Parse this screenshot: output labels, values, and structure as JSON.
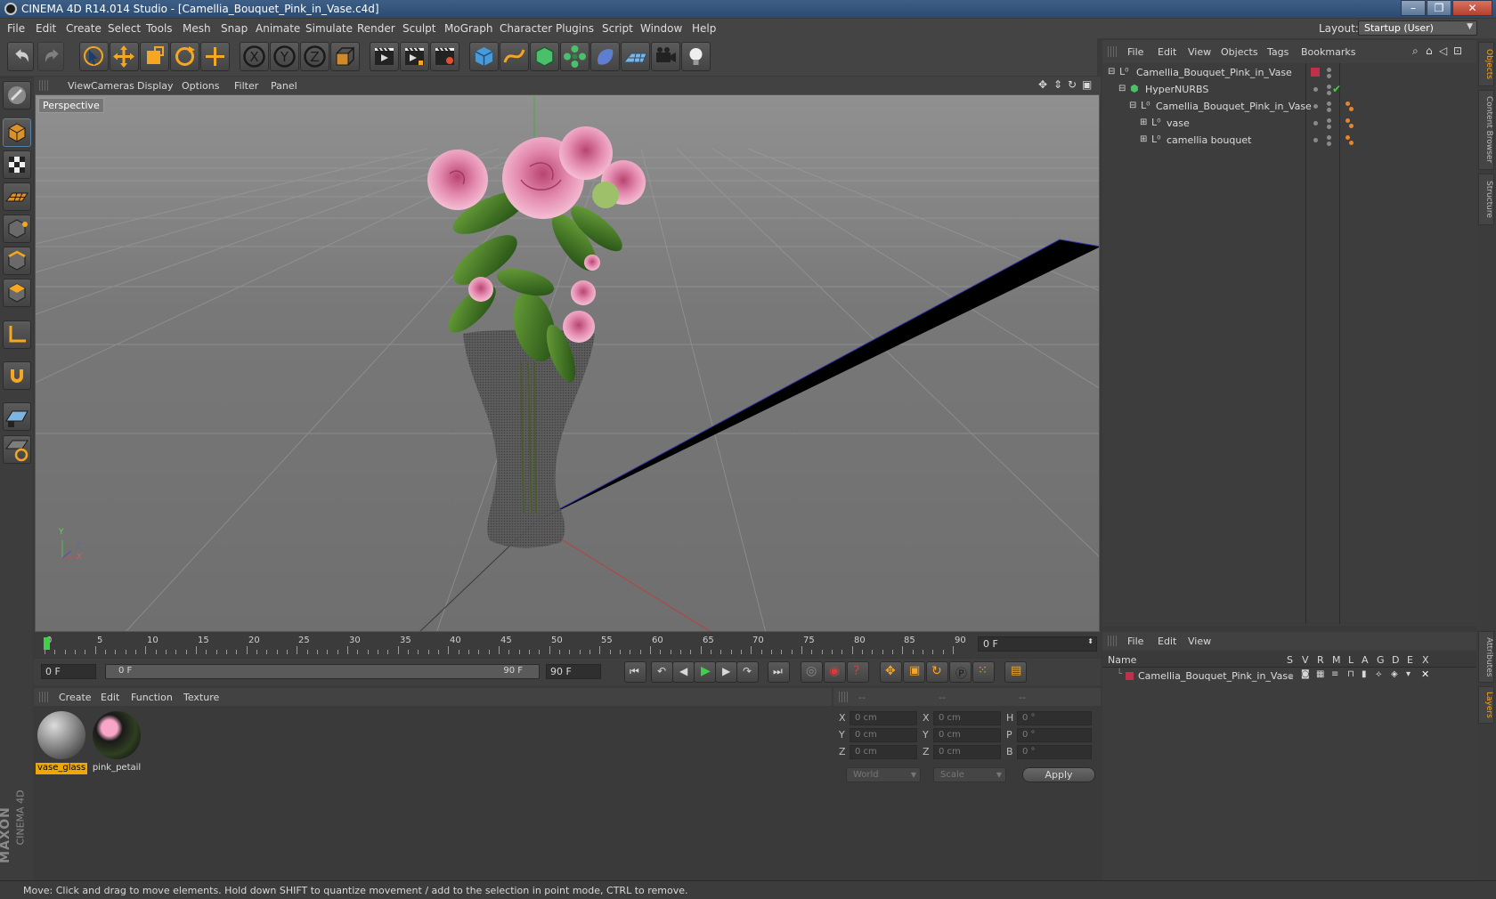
{
  "window": {
    "title": "CINEMA 4D R14.014 Studio - [Camellia_Bouquet_Pink_in_Vase.c4d]",
    "minimize": "–",
    "maximize": "❐",
    "close": "✕"
  },
  "menubar": {
    "items": [
      "File",
      "Edit",
      "Create",
      "Select",
      "Tools",
      "Mesh",
      "Snap",
      "Animate",
      "Simulate",
      "Render",
      "Sculpt",
      "MoGraph",
      "Character",
      "Plugins",
      "Script",
      "Window",
      "Help"
    ],
    "layout_label": "Layout:",
    "layout_value": "Startup (User)"
  },
  "toolbar": {
    "icons": [
      "undo-icon",
      "redo-icon",
      "live-select-icon",
      "move-icon",
      "scale-icon",
      "rotate-icon",
      "create-object-icon",
      "x-axis-icon",
      "y-axis-icon",
      "z-axis-icon",
      "coordinate-system-icon",
      "render-view-icon",
      "render-picture-viewer-icon",
      "edit-render-settings-icon",
      "cube-icon",
      "spline-pen-icon",
      "nurbs-icon",
      "array-icon",
      "deformer-icon",
      "floor-icon",
      "camera-icon",
      "light-icon"
    ]
  },
  "left_tools": {
    "icons": [
      "make-editable-icon",
      "model-mode-icon",
      "texture-mode-icon",
      "workplane-mode-icon",
      "points-mode-icon",
      "edges-mode-icon",
      "polygons-mode-icon",
      "axis-mode-icon",
      "magnet-icon",
      "snap-icon",
      "lock-workplane-icon"
    ]
  },
  "viewport": {
    "menu": [
      "View",
      "Cameras",
      "Display",
      "Options",
      "Filter",
      "Panel"
    ],
    "label": "Perspective",
    "axis_labels": {
      "y": "Y",
      "z": "Z",
      "x": "X"
    }
  },
  "timeline": {
    "ticks": [
      "0",
      "5",
      "10",
      "15",
      "20",
      "25",
      "30",
      "35",
      "40",
      "45",
      "50",
      "55",
      "60",
      "65",
      "70",
      "75",
      "80",
      "85",
      "90"
    ],
    "current_frame": "0 F"
  },
  "playbar": {
    "start_field": "0 F",
    "range_start": "0 F",
    "range_end": "90 F",
    "end_field": "90 F"
  },
  "material_manager": {
    "menu": [
      "Create",
      "Edit",
      "Function",
      "Texture"
    ],
    "materials": [
      {
        "name": "vase_glass",
        "selected": true
      },
      {
        "name": "pink_petail",
        "selected": false
      }
    ]
  },
  "coordinates": {
    "header": [
      "--",
      "--",
      "--"
    ],
    "rows": [
      {
        "axis": "X",
        "pos": "0 cm",
        "axis2": "X",
        "size": "0 cm",
        "rot_label": "H",
        "rot": "0 °"
      },
      {
        "axis": "Y",
        "pos": "0 cm",
        "axis2": "Y",
        "size": "0 cm",
        "rot_label": "P",
        "rot": "0 °"
      },
      {
        "axis": "Z",
        "pos": "0 cm",
        "axis2": "Z",
        "size": "0 cm",
        "rot_label": "B",
        "rot": "0 °"
      }
    ],
    "mode_world": "World",
    "mode_scale": "Scale",
    "apply": "Apply"
  },
  "object_manager": {
    "menu": [
      "File",
      "Edit",
      "View",
      "Objects",
      "Tags",
      "Bookmarks"
    ],
    "objects": [
      {
        "name": "Camellia_Bouquet_Pink_in_Vase",
        "indent": 0
      },
      {
        "name": "HyperNURBS",
        "indent": 1
      },
      {
        "name": "Camellia_Bouquet_Pink_in_Vase",
        "indent": 2
      },
      {
        "name": "vase",
        "indent": 3
      },
      {
        "name": "camellia bouquet",
        "indent": 3
      }
    ]
  },
  "layer_manager": {
    "menu": [
      "File",
      "Edit",
      "View"
    ],
    "columns": [
      "Name",
      "S",
      "V",
      "R",
      "M",
      "L",
      "A",
      "G",
      "D",
      "E",
      "X"
    ],
    "layers": [
      {
        "name": "Camellia_Bouquet_Pink_in_Vase",
        "color": "#c0304a"
      }
    ]
  },
  "right_tabs": [
    "Objects",
    "Content Browser",
    "Structure",
    "Attributes",
    "Layers"
  ],
  "status": {
    "text": "Move: Click and drag to move elements. Hold down SHIFT to quantize movement / add to the selection in point mode, CTRL to remove."
  },
  "brand": {
    "maxon": "MAXON",
    "product": "CINEMA 4D"
  },
  "colors": {
    "accent": "#f5a623",
    "selection": "#f0a800",
    "layer_red": "#c0304a"
  }
}
